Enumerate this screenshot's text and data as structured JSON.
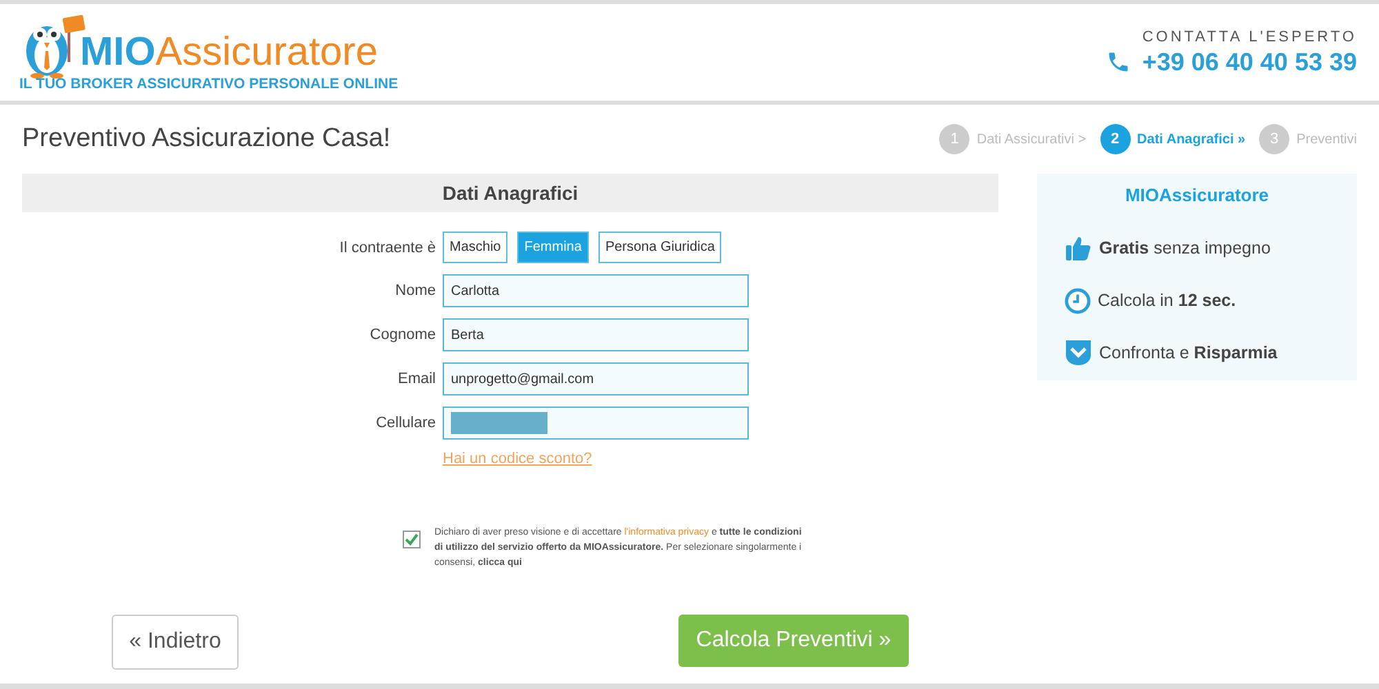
{
  "header": {
    "brand_first": "MIO",
    "brand_second": "Assicuratore",
    "tagline": "IL TUO BROKER ASSICURATIVO PERSONALE ONLINE",
    "contact_label": "CONTATTA L'ESPERTO",
    "phone": "+39 06 40 40 53 39"
  },
  "page_title": "Preventivo Assicurazione Casa!",
  "steps": [
    {
      "number": "1",
      "label": "Dati Assicurativi >",
      "selected": false
    },
    {
      "number": "2",
      "label": "Dati Anagrafici »",
      "selected": true
    },
    {
      "number": "3",
      "label": "Preventivi",
      "selected": false
    }
  ],
  "form": {
    "title": "Dati Anagrafici",
    "contraente_label": "Il contraente è",
    "options": [
      {
        "label": "Maschio",
        "selected": false
      },
      {
        "label": "Femmina",
        "selected": true
      },
      {
        "label": "Persona Giuridica",
        "selected": false
      }
    ],
    "fields": [
      {
        "label": "Nome",
        "value": "Carlotta",
        "redacted": false
      },
      {
        "label": "Cognome",
        "value": "Berta",
        "redacted": false
      },
      {
        "label": "Email",
        "value": "unprogetto@gmail.com",
        "redacted": false
      },
      {
        "label": "Cellulare",
        "redacted": true
      }
    ],
    "discount_link": "Hai un codice sconto?",
    "consent": {
      "checked": true,
      "before": "Dichiaro di aver preso visione e di accettare",
      "link": "l'informativa privacy",
      "after": "e **tutte le condizioni di utilizzo del servizio offerto da MIOAssicuratore.** Per selezionare singolarmente i consensi, **clicca qui**"
    }
  },
  "sidebar": {
    "title": "MIOAssicuratore",
    "features": [
      {
        "kind": "thumb",
        "text": "**Gratis** senza impegno"
      },
      {
        "kind": "clock",
        "text": "Calcola in **12 sec.**"
      },
      {
        "kind": "shield",
        "text": "Confronta e **Risparmia**"
      }
    ]
  },
  "buttons": {
    "back": "« Indietro",
    "next": "Calcola Preventivi »"
  }
}
